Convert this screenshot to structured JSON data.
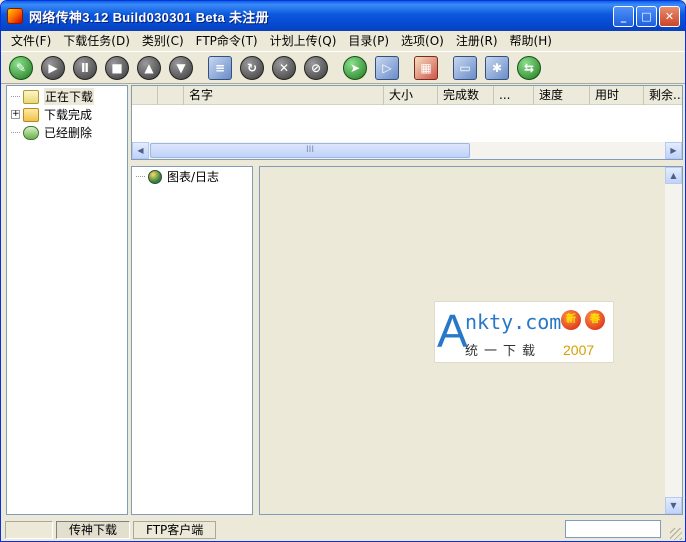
{
  "window": {
    "title": "网络传神3.12 Build030301 Beta 未注册",
    "controls": {
      "minimize": "_",
      "maximize": "□",
      "close": "✕"
    }
  },
  "menu": [
    "文件(F)",
    "下载任务(D)",
    "类别(C)",
    "FTP命令(T)",
    "计划上传(Q)",
    "目录(P)",
    "选项(O)",
    "注册(R)",
    "帮助(H)"
  ],
  "toolbar": {
    "buttons": [
      {
        "icon": "new-task-icon",
        "glyph": "✎"
      },
      {
        "icon": "start-icon",
        "glyph": "▶"
      },
      {
        "icon": "pause-icon",
        "glyph": "Ⅱ"
      },
      {
        "icon": "stop-icon",
        "glyph": "■"
      },
      {
        "icon": "move-up-icon",
        "glyph": "▲"
      },
      {
        "icon": "move-down-icon",
        "glyph": "▼"
      },
      {
        "icon": "properties-icon",
        "glyph": "≡"
      },
      {
        "icon": "refresh-icon",
        "glyph": "↻"
      },
      {
        "icon": "delete-icon",
        "glyph": "✕"
      },
      {
        "icon": "disconnect-icon",
        "glyph": "⊘"
      },
      {
        "icon": "run-icon",
        "glyph": "➤"
      },
      {
        "icon": "play-icon",
        "glyph": "▷"
      },
      {
        "icon": "schedule-icon",
        "glyph": "▦"
      },
      {
        "icon": "monitor-icon",
        "glyph": "▭"
      },
      {
        "icon": "options-icon",
        "glyph": "✱"
      },
      {
        "icon": "connect-icon",
        "glyph": "⇆"
      }
    ]
  },
  "tree": {
    "items": [
      {
        "label": "正在下载",
        "icon": "downloading-icon",
        "selected": true
      },
      {
        "label": "下载完成",
        "icon": "folder-icon",
        "expandable": true
      },
      {
        "label": "已经删除",
        "icon": "recycle-icon"
      }
    ]
  },
  "list": {
    "columns": [
      "",
      "",
      "名字",
      "大小",
      "完成数",
      "...",
      "速度",
      "用时",
      "剩余..."
    ],
    "scroll_thumb": "III"
  },
  "tree2": {
    "items": [
      {
        "label": "图表/日志",
        "icon": "globe-icon"
      }
    ]
  },
  "watermark": {
    "letter": "A",
    "site": "nkty.com",
    "cn": "统一下载",
    "year": "2007",
    "lantern1": "新",
    "lantern2": "春"
  },
  "statusbar": {
    "tabs": [
      {
        "label": "传神下载",
        "active": true
      },
      {
        "label": "FTP客户端",
        "active": false
      }
    ]
  },
  "colors": {
    "titlebar": "#0b58dd",
    "face": "#ece9d8",
    "border": "#7f9db9",
    "watermark_blue": "#2878c8",
    "watermark_gold": "#d4a000"
  }
}
